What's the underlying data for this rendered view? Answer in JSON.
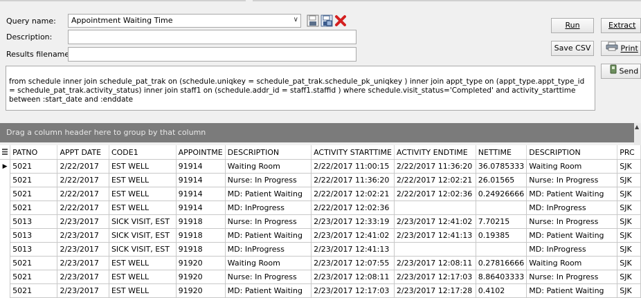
{
  "form": {
    "query_name_label": "Query name:",
    "query_name_value": "Appointment Waiting Time",
    "description_label": "Description:",
    "description_value": "",
    "results_filename_label": "Results filename:",
    "results_filename_value": "",
    "sql_text": "from schedule inner join schedule_pat_trak on (schedule.uniqkey = schedule_pat_trak.schedule_pk_uniqkey ) inner join appt_type on (appt_type.appt_type_id = schedule_pat_trak.activity_status) inner join staff1 on (schedule.addr_id = staff1.staffid ) where schedule.visit_status='Completed' and activity_starttime between :start_date and :enddate"
  },
  "toolbar_icons": [
    "save-icon",
    "save-as-icon",
    "delete-icon"
  ],
  "buttons": {
    "run": "Run",
    "extract": "Extract",
    "save_csv": "Save CSV",
    "print": "Print",
    "send": "Send"
  },
  "grid": {
    "group_hint": "Drag a column header here to group by that column",
    "columns": [
      "PATNO",
      "APPT DATE",
      "CODE1",
      "APPOINTME",
      "DESCRIPTION",
      "ACTIVITY STARTTIME",
      "ACTIVITY ENDTIME",
      "NETTIME",
      "DESCRIPTION",
      "PRC"
    ],
    "rows": [
      [
        "5021",
        "2/22/2017",
        "EST WELL",
        "91914",
        "Waiting Room",
        "2/22/2017 11:00:15",
        "2/22/2017 11:36:20",
        "36.0785333",
        "Waiting Room",
        "SJK"
      ],
      [
        "5021",
        "2/22/2017",
        "EST WELL",
        "91914",
        "Nurse: In Progress",
        "2/22/2017 11:36:20",
        "2/22/2017 12:02:21",
        "26.01565",
        "Nurse: In Progress",
        "SJK"
      ],
      [
        "5021",
        "2/22/2017",
        "EST WELL",
        "91914",
        "MD: Patient Waiting",
        "2/22/2017 12:02:21",
        "2/22/2017 12:02:36",
        "0.24926666",
        "MD: Patient Waiting",
        "SJK"
      ],
      [
        "5021",
        "2/22/2017",
        "EST WELL",
        "91914",
        "MD: InProgress",
        "2/22/2017 12:02:36",
        "",
        "",
        "MD: InProgress",
        "SJK"
      ],
      [
        "5013",
        "2/23/2017",
        "SICK VISIT, EST",
        "91918",
        "Nurse: In Progress",
        "2/23/2017 12:33:19",
        "2/23/2017 12:41:02",
        "7.70215",
        "Nurse: In Progress",
        "SJK"
      ],
      [
        "5013",
        "2/23/2017",
        "SICK VISIT, EST",
        "91918",
        "MD: Patient Waiting",
        "2/23/2017 12:41:02",
        "2/23/2017 12:41:13",
        "0.19385",
        "MD: Patient Waiting",
        "SJK"
      ],
      [
        "5013",
        "2/23/2017",
        "SICK VISIT, EST",
        "91918",
        "MD: InProgress",
        "2/23/2017 12:41:13",
        "",
        "",
        "MD: InProgress",
        "SJK"
      ],
      [
        "5021",
        "2/23/2017",
        "EST WELL",
        "91920",
        "Waiting Room",
        "2/23/2017 12:07:55",
        "2/23/2017 12:08:11",
        "0.27816666",
        "Waiting Room",
        "SJK"
      ],
      [
        "5021",
        "2/23/2017",
        "EST WELL",
        "91920",
        "Nurse: In Progress",
        "2/23/2017 12:08:11",
        "2/23/2017 12:17:03",
        "8.86403333",
        "Nurse: In Progress",
        "SJK"
      ],
      [
        "5021",
        "2/23/2017",
        "EST WELL",
        "91920",
        "MD: Patient Waiting",
        "2/23/2017 12:17:03",
        "2/23/2017 12:17:28",
        "0.4102",
        "MD: Patient Waiting",
        "SJK"
      ]
    ]
  }
}
